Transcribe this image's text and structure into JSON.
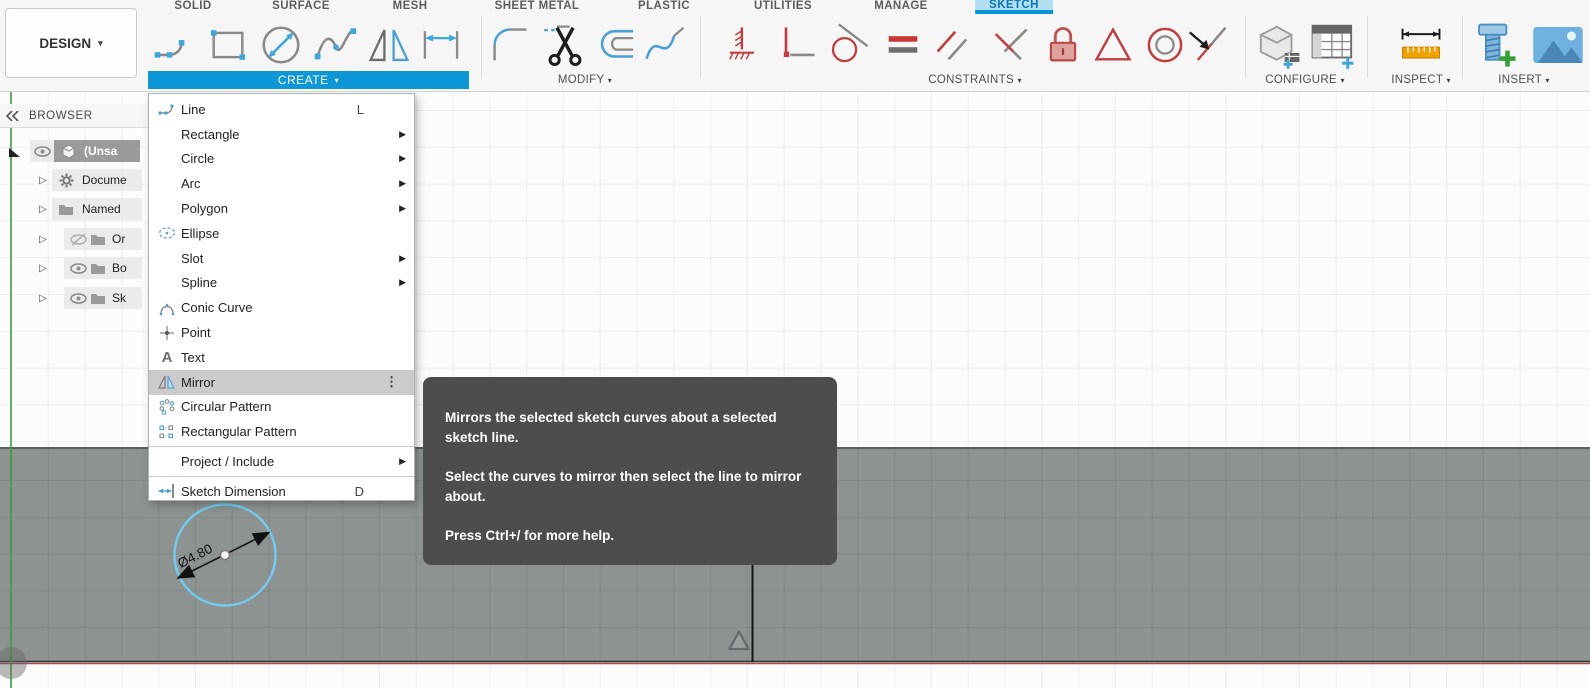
{
  "app": {
    "design_label": "DESIGN"
  },
  "tabs": {
    "items": [
      {
        "label": "SOLID"
      },
      {
        "label": "SURFACE"
      },
      {
        "label": "MESH"
      },
      {
        "label": "SHEET METAL"
      },
      {
        "label": "PLASTIC"
      },
      {
        "label": "UTILITIES"
      },
      {
        "label": "MANAGE"
      },
      {
        "label": "SKETCH",
        "active": true
      }
    ]
  },
  "toolbar": {
    "groups": {
      "create": {
        "label": "CREATE"
      },
      "modify": {
        "label": "MODIFY"
      },
      "constraints": {
        "label": "CONSTRAINTS"
      },
      "configure": {
        "label": "CONFIGURE"
      },
      "inspect": {
        "label": "INSPECT"
      },
      "insert": {
        "label": "INSERT"
      }
    }
  },
  "browser": {
    "title": "BROWSER",
    "items": [
      {
        "label": "(Unsa"
      },
      {
        "label": "Docume"
      },
      {
        "label": "Named"
      },
      {
        "label": "Or",
        "hidden_eye": true
      },
      {
        "label": "Bo"
      },
      {
        "label": "Sk"
      }
    ]
  },
  "menu": {
    "items": [
      {
        "label": "Line",
        "shortcut": "L"
      },
      {
        "label": "Rectangle",
        "submenu": true
      },
      {
        "label": "Circle",
        "submenu": true
      },
      {
        "label": "Arc",
        "submenu": true
      },
      {
        "label": "Polygon",
        "submenu": true
      },
      {
        "label": "Ellipse"
      },
      {
        "label": "Slot",
        "submenu": true
      },
      {
        "label": "Spline",
        "submenu": true
      },
      {
        "label": "Conic Curve"
      },
      {
        "label": "Point"
      },
      {
        "label": "Text"
      },
      {
        "label": "Mirror",
        "highlighted": true
      },
      {
        "label": "Circular Pattern"
      },
      {
        "label": "Rectangular Pattern"
      },
      {
        "label": "Project / Include",
        "submenu": true
      },
      {
        "label": "Sketch Dimension",
        "shortcut": "D"
      }
    ]
  },
  "tooltip": {
    "paragraphs": [
      "Mirrors the selected sketch curves about a selected sketch line.",
      "Select the curves to mirror then select the line to mirror about.",
      "Press Ctrl+/ for more help."
    ]
  },
  "canvas": {
    "dimension_label": "Ø4.80"
  },
  "colors": {
    "accent_blue": "#0696d7",
    "tab_highlight": "#b3ddf1",
    "tooltip_bg": "#4d4d4d",
    "body_fill": "#8c9390",
    "axis_red": "#a84848",
    "axis_green": "#3f9e3f",
    "sketch_blue": "#74cbf2",
    "constraint_red": "#c0504d"
  }
}
